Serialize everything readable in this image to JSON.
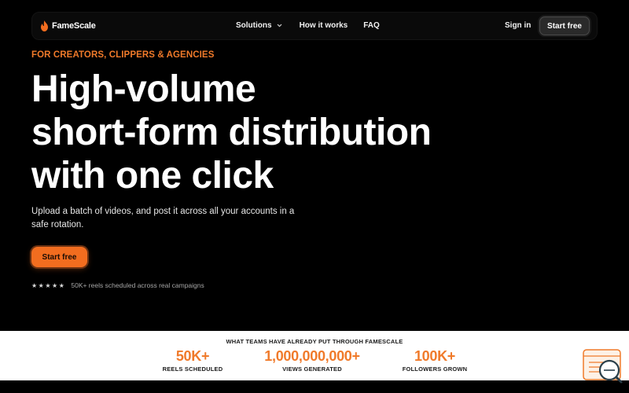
{
  "brand": {
    "name": "FameScale"
  },
  "nav": {
    "solutions": "Solutions",
    "how_it_works": "How it works",
    "faq": "FAQ",
    "signin": "Sign in",
    "cta": "Start free"
  },
  "hero": {
    "eyebrow": "FOR CREATORS, CLIPPERS & AGENCIES",
    "headline_lines": [
      "High-volume",
      "short-form distribution",
      "with one click"
    ],
    "subtext": "Upload a batch of videos, and post it across all your accounts in a safe rotation.",
    "cta": "Start free",
    "stars": "★★★★★",
    "proof": "50K+ reels scheduled across real campaigns"
  },
  "stats": {
    "title": "WHAT TEAMS HAVE ALREADY PUT THROUGH FAMESCALE",
    "items": [
      {
        "value": "50K+",
        "label": "REELS SCHEDULED"
      },
      {
        "value": "1,000,000,000+",
        "label": "VIEWS GENERATED"
      },
      {
        "value": "100K+",
        "label": "FOLLOWERS GROWN"
      }
    ]
  },
  "colors": {
    "accent": "#f26d1f",
    "eyebrow": "#f07a2a",
    "background": "#000000",
    "band": "#ffffff"
  },
  "icons": [
    "flame-logo-icon",
    "chevron-down-icon",
    "star-icon",
    "search-widget-icon"
  ]
}
